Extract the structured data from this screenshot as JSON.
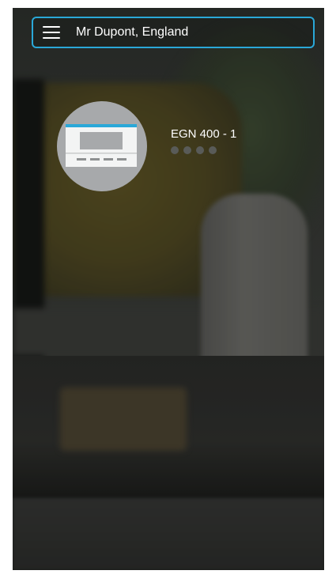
{
  "header": {
    "location_title": "Mr Dupont, England",
    "menu_icon": "menu-icon"
  },
  "devices": [
    {
      "name": "EGN 400 - 1",
      "icon": "thermostat-device-icon",
      "status_indicator_count": 4
    }
  ],
  "colors": {
    "accent": "#2aa8d8",
    "avatar_bg": "#a7a9ab",
    "dot_inactive": "#595b58"
  }
}
